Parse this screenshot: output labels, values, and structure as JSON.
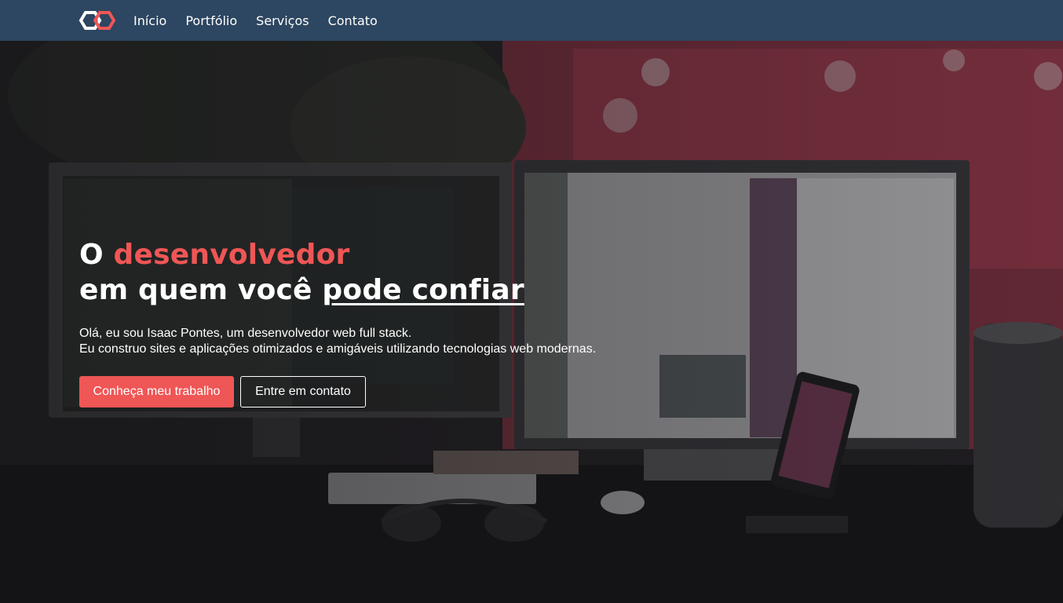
{
  "brand": {
    "logo_icon": "hexagon-link-logo",
    "colors": {
      "primary": "#ef5656",
      "nav_bg": "#2d4661"
    }
  },
  "nav": {
    "items": [
      {
        "label": "Início"
      },
      {
        "label": "Portfólio"
      },
      {
        "label": "Serviços"
      },
      {
        "label": "Contato"
      }
    ]
  },
  "hero": {
    "title_line1_prefix": "O ",
    "title_line1_accent": "desenvolvedor",
    "title_line2_prefix": "em quem você ",
    "title_line2_underlined": "pode confiar",
    "intro_line1": "Olá, eu sou Isaac Pontes, um desenvolvedor web full stack.",
    "intro_line2": "Eu construo sites e aplicações otimizados e amigáveis utilizando tecnologias web modernas.",
    "primary_button": "Conheça meu trabalho",
    "secondary_button": "Entre em contato"
  }
}
